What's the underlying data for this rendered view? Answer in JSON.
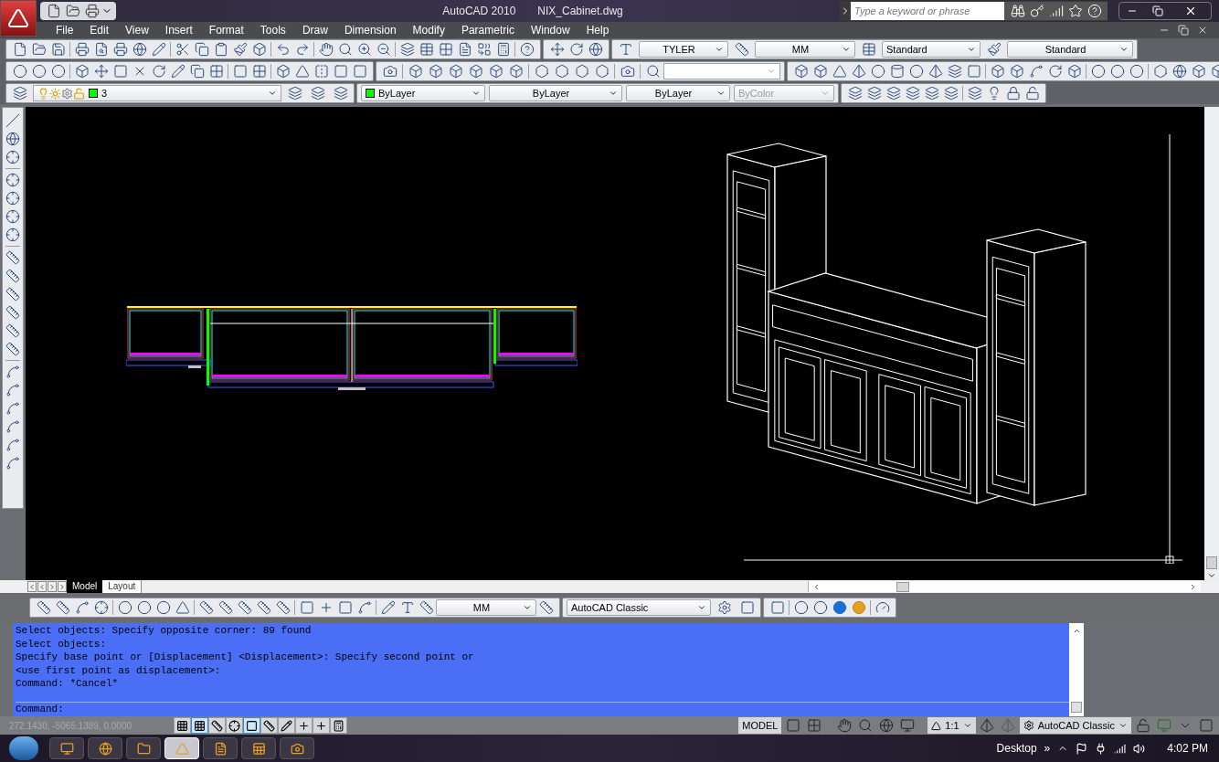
{
  "title_bar": {
    "app_title": "AutoCAD 2010",
    "file_name": "NIX_Cabinet.dwg",
    "search": {
      "placeholder": "Type a keyword or phrase"
    }
  },
  "menu": [
    "File",
    "Edit",
    "View",
    "Insert",
    "Format",
    "Tools",
    "Draw",
    "Dimension",
    "Modify",
    "Parametric",
    "Window",
    "Help"
  ],
  "styles_toolbar": {
    "text_style": "TYLER",
    "dim_style": "MM",
    "table_style": "Standard",
    "multileader_style": "Standard"
  },
  "properties_toolbar": {
    "layer": {
      "name": "3",
      "color": "#00ff00"
    },
    "color": {
      "value": "ByLayer",
      "color": "#00ff00"
    },
    "linetype": "ByLayer",
    "lineweight": "ByLayer",
    "plot_style": {
      "value": "ByColor",
      "disabled": true
    }
  },
  "layout_tabs": [
    {
      "label": "Model",
      "selected": true
    },
    {
      "label": "Layout",
      "selected": false
    }
  ],
  "dimension_toolbar": {
    "dim_style": "MM",
    "workspace": "AutoCAD Classic"
  },
  "command_history": [
    "Select objects: Specify opposite corner: 89 found",
    "Select objects:",
    "Specify base point or [Displacement] <Displacement>: Specify second point or",
    "<use first point as displacement>:",
    "Command: *Cancel*"
  ],
  "command_prompt": "Command:",
  "status_bar": {
    "coordinates": "272.1430, -5065.1389, 0.0000",
    "toggles": [
      {
        "on": false
      },
      {
        "on": true
      },
      {
        "on": false
      },
      {
        "on": false
      },
      {
        "on": true
      },
      {
        "on": false
      },
      {
        "on": false
      },
      {
        "on": false
      },
      {
        "on": false
      },
      {
        "on": false
      }
    ],
    "space": "MODEL",
    "annotation_scale": "1:1",
    "workspace": "AutoCAD Classic"
  },
  "taskbar": {
    "apps": [
      {
        "selected": false
      },
      {
        "selected": false
      },
      {
        "selected": false
      },
      {
        "selected": true
      },
      {
        "selected": false
      },
      {
        "selected": false
      },
      {
        "selected": false
      }
    ],
    "desktop": "Desktop",
    "chevron": "»",
    "time": "4:02 PM"
  }
}
